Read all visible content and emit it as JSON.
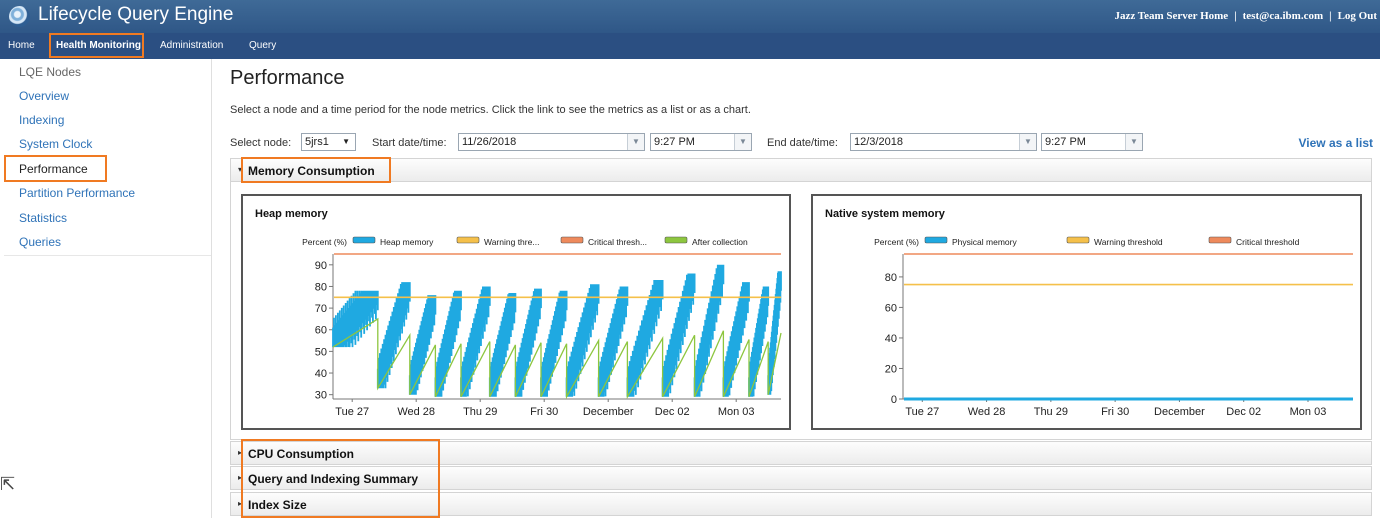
{
  "app": {
    "title": "Lifecycle Query Engine"
  },
  "top_links": {
    "jts_home": "Jazz Team Server Home",
    "user": "test@ca.ibm.com",
    "logout": "Log Out",
    "sep": "|"
  },
  "nav": {
    "home": "Home",
    "health": "Health Monitoring",
    "admin": "Administration",
    "query": "Query"
  },
  "sidebar": {
    "items": [
      {
        "label": "LQE Nodes"
      },
      {
        "label": "Overview"
      },
      {
        "label": "Indexing"
      },
      {
        "label": "System Clock"
      },
      {
        "label": "Performance"
      },
      {
        "label": "Partition Performance"
      },
      {
        "label": "Statistics"
      },
      {
        "label": "Queries"
      }
    ]
  },
  "main": {
    "title": "Performance",
    "description": "Select a node and a time period for the node metrics. Click the link to see the metrics as a list or as a chart.",
    "select_node_label": "Select node:",
    "node_value": "5jrs1",
    "start_label": "Start date/time:",
    "start_date": "11/26/2018",
    "start_time": "9:27 PM",
    "end_label": "End date/time:",
    "end_date": "12/3/2018",
    "end_time": "9:27 PM",
    "view_link": "View as a list",
    "sections": [
      {
        "label": "Memory Consumption",
        "expanded": true
      },
      {
        "label": "CPU Consumption",
        "expanded": false
      },
      {
        "label": "Query and Indexing Summary",
        "expanded": false
      },
      {
        "label": "Index Size",
        "expanded": false
      }
    ]
  },
  "colors": {
    "heap": "#1fa9e1",
    "warning": "#f5c04a",
    "critical": "#ee8a5c",
    "after": "#8dc63f",
    "highlight": "#f07a22"
  },
  "chart_data": [
    {
      "type": "line",
      "title": "Heap memory",
      "ylabel": "Percent (%)",
      "ylim": [
        28,
        95
      ],
      "yticks": [
        30,
        40,
        50,
        60,
        70,
        80,
        90
      ],
      "xlim": [
        0,
        7
      ],
      "x_ticks": [
        {
          "x": 0.3,
          "label": "Tue 27"
        },
        {
          "x": 1.3,
          "label": "Wed 28"
        },
        {
          "x": 2.3,
          "label": "Thu 29"
        },
        {
          "x": 3.3,
          "label": "Fri 30"
        },
        {
          "x": 4.3,
          "label": "December"
        },
        {
          "x": 5.3,
          "label": "Dec 02"
        },
        {
          "x": 6.3,
          "label": "Mon 03"
        }
      ],
      "legend": [
        "Heap memory",
        "Warning thre...",
        "Critical thresh...",
        "After collection"
      ],
      "series": [
        {
          "name": "Heap memory",
          "kind": "sawtooth",
          "cycles": [
            [
              0.0,
              0.7,
              52,
              78
            ],
            [
              0.7,
              1.2,
              33,
              82
            ],
            [
              1.2,
              1.6,
              30,
              76
            ],
            [
              1.6,
              2.0,
              29,
              78
            ],
            [
              2.0,
              2.45,
              29,
              80
            ],
            [
              2.45,
              2.85,
              29,
              77
            ],
            [
              2.85,
              3.25,
              29,
              79
            ],
            [
              3.25,
              3.65,
              29,
              78
            ],
            [
              3.65,
              4.15,
              29,
              81
            ],
            [
              4.15,
              4.6,
              29,
              80
            ],
            [
              4.6,
              5.15,
              29,
              83
            ],
            [
              5.15,
              5.65,
              29,
              86
            ],
            [
              5.65,
              6.1,
              29,
              90
            ],
            [
              6.1,
              6.5,
              29,
              82
            ],
            [
              6.5,
              6.8,
              29,
              80
            ],
            [
              6.8,
              7.0,
              30,
              87
            ]
          ]
        },
        {
          "name": "Warning thre...",
          "kind": "constant",
          "value": 75
        },
        {
          "name": "Critical thresh...",
          "kind": "constant",
          "value": 95
        },
        {
          "name": "After collection",
          "kind": "sawtooth-floor"
        }
      ]
    },
    {
      "type": "line",
      "title": "Native system memory",
      "ylabel": "Percent (%)",
      "ylim": [
        0,
        95
      ],
      "yticks": [
        0,
        20,
        40,
        60,
        80
      ],
      "xlim": [
        0,
        7
      ],
      "x_ticks": [
        {
          "x": 0.3,
          "label": "Tue 27"
        },
        {
          "x": 1.3,
          "label": "Wed 28"
        },
        {
          "x": 2.3,
          "label": "Thu 29"
        },
        {
          "x": 3.3,
          "label": "Fri 30"
        },
        {
          "x": 4.3,
          "label": "December"
        },
        {
          "x": 5.3,
          "label": "Dec 02"
        },
        {
          "x": 6.3,
          "label": "Mon 03"
        }
      ],
      "legend": [
        "Physical memory",
        "Warning threshold",
        "Critical threshold"
      ],
      "series": [
        {
          "name": "Physical memory",
          "kind": "constant",
          "value": 0
        },
        {
          "name": "Warning threshold",
          "kind": "constant",
          "value": 75
        },
        {
          "name": "Critical threshold",
          "kind": "constant",
          "value": 95
        }
      ]
    }
  ]
}
